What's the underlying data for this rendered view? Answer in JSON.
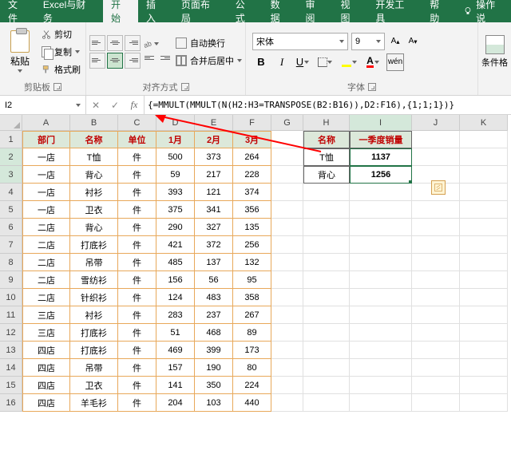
{
  "tabs": {
    "file": "文件",
    "custom": "Excel与财务",
    "home": "开始",
    "insert": "插入",
    "layout": "页面布局",
    "formula": "公式",
    "data": "数据",
    "review": "审阅",
    "view": "视图",
    "dev": "开发工具",
    "help": "帮助",
    "tell_me": "操作说"
  },
  "clipboard": {
    "paste": "粘贴",
    "cut": "剪切",
    "copy": "复制",
    "format_painter": "格式刷",
    "group_label": "剪贴板"
  },
  "alignment": {
    "wrap": "自动换行",
    "merge": "合并后居中",
    "group_label": "对齐方式"
  },
  "font": {
    "name": "宋体",
    "size": "9",
    "group_label": "字体",
    "wen": "wén"
  },
  "styles": {
    "cond_format": "条件格"
  },
  "namebox": "I2",
  "formula": "{=MMULT(MMULT(N(H2:H3=TRANSPOSE(B2:B16)),D2:F16),{1;1;1})}",
  "cols": [
    "A",
    "B",
    "C",
    "D",
    "E",
    "F",
    "G",
    "H",
    "I",
    "J",
    "K"
  ],
  "table": {
    "headers": [
      "部门",
      "名称",
      "单位",
      "1月",
      "2月",
      "3月"
    ],
    "rows": [
      [
        "一店",
        "T恤",
        "件",
        "500",
        "373",
        "264"
      ],
      [
        "一店",
        "背心",
        "件",
        "59",
        "217",
        "228"
      ],
      [
        "一店",
        "衬衫",
        "件",
        "393",
        "121",
        "374"
      ],
      [
        "一店",
        "卫衣",
        "件",
        "375",
        "341",
        "356"
      ],
      [
        "二店",
        "背心",
        "件",
        "290",
        "327",
        "135"
      ],
      [
        "二店",
        "打底衫",
        "件",
        "421",
        "372",
        "256"
      ],
      [
        "二店",
        "吊带",
        "件",
        "485",
        "137",
        "132"
      ],
      [
        "二店",
        "雪纺衫",
        "件",
        "156",
        "56",
        "95"
      ],
      [
        "二店",
        "针织衫",
        "件",
        "124",
        "483",
        "358"
      ],
      [
        "三店",
        "衬衫",
        "件",
        "283",
        "237",
        "267"
      ],
      [
        "三店",
        "打底衫",
        "件",
        "51",
        "468",
        "89"
      ],
      [
        "四店",
        "打底衫",
        "件",
        "469",
        "399",
        "173"
      ],
      [
        "四店",
        "吊带",
        "件",
        "157",
        "190",
        "80"
      ],
      [
        "四店",
        "卫衣",
        "件",
        "141",
        "350",
        "224"
      ],
      [
        "四店",
        "羊毛衫",
        "件",
        "204",
        "103",
        "440"
      ]
    ]
  },
  "summary": {
    "headers": [
      "名称",
      "一季度销量"
    ],
    "rows": [
      [
        "T恤",
        "1137"
      ],
      [
        "背心",
        "1256"
      ]
    ]
  }
}
